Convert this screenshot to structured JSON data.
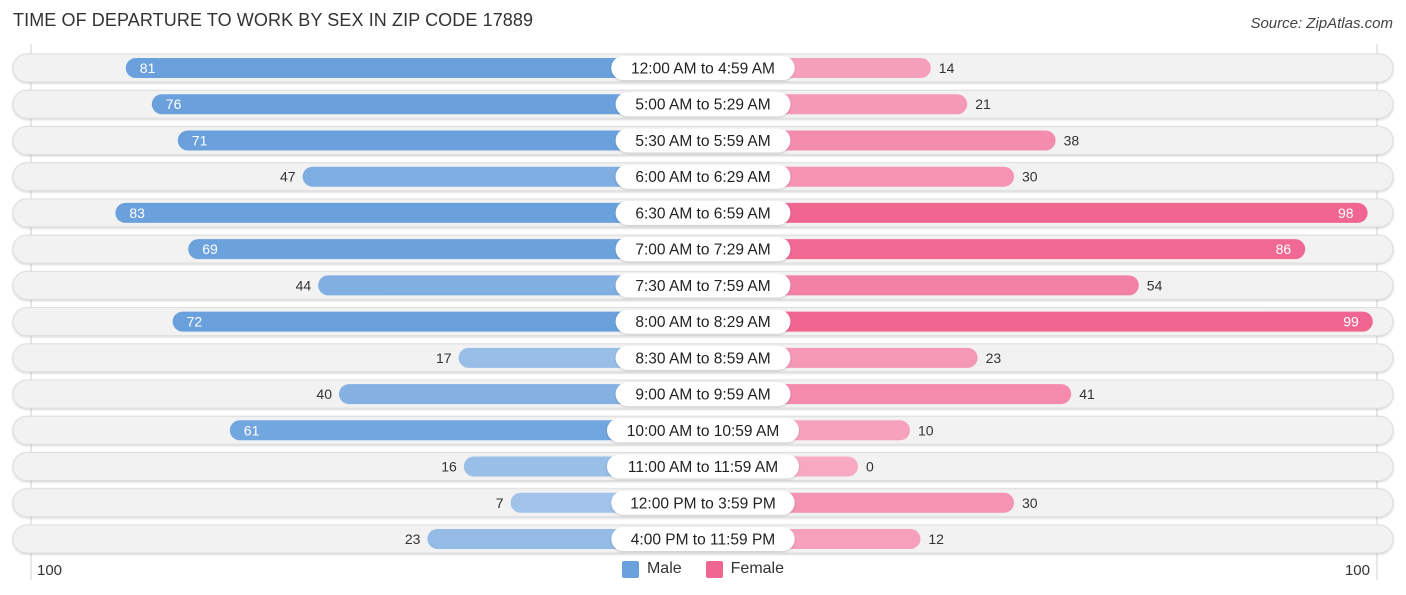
{
  "title": "TIME OF DEPARTURE TO WORK BY SEX IN ZIP CODE 17889",
  "source": "Source: ZipAtlas.com",
  "colors": {
    "male_strong": "#6aa1dc",
    "male_light": "#a7c7ea",
    "female_strong": "#f06691",
    "female_light": "#f7a9c2",
    "track": "#f2f2f2"
  },
  "chart_data": {
    "type": "bar",
    "orientation": "horizontal-diverging",
    "title": "TIME OF DEPARTURE TO WORK BY SEX IN ZIP CODE 17889",
    "categories": [
      "12:00 AM to 4:59 AM",
      "5:00 AM to 5:29 AM",
      "5:30 AM to 5:59 AM",
      "6:00 AM to 6:29 AM",
      "6:30 AM to 6:59 AM",
      "7:00 AM to 7:29 AM",
      "7:30 AM to 7:59 AM",
      "8:00 AM to 8:29 AM",
      "8:30 AM to 8:59 AM",
      "9:00 AM to 9:59 AM",
      "10:00 AM to 10:59 AM",
      "11:00 AM to 11:59 AM",
      "12:00 PM to 3:59 PM",
      "4:00 PM to 11:59 PM"
    ],
    "series": [
      {
        "name": "Male",
        "side": "left",
        "values": [
          81,
          76,
          71,
          47,
          83,
          69,
          44,
          72,
          17,
          40,
          61,
          16,
          7,
          23
        ]
      },
      {
        "name": "Female",
        "side": "right",
        "values": [
          14,
          21,
          38,
          30,
          98,
          86,
          54,
          99,
          23,
          41,
          10,
          0,
          30,
          12
        ]
      }
    ],
    "axis": {
      "left_label": "100",
      "right_label": "100",
      "range": [
        0,
        100
      ]
    },
    "legend": {
      "position": "bottom-center",
      "entries": [
        "Male",
        "Female"
      ]
    },
    "xlabel": "",
    "ylabel": ""
  }
}
